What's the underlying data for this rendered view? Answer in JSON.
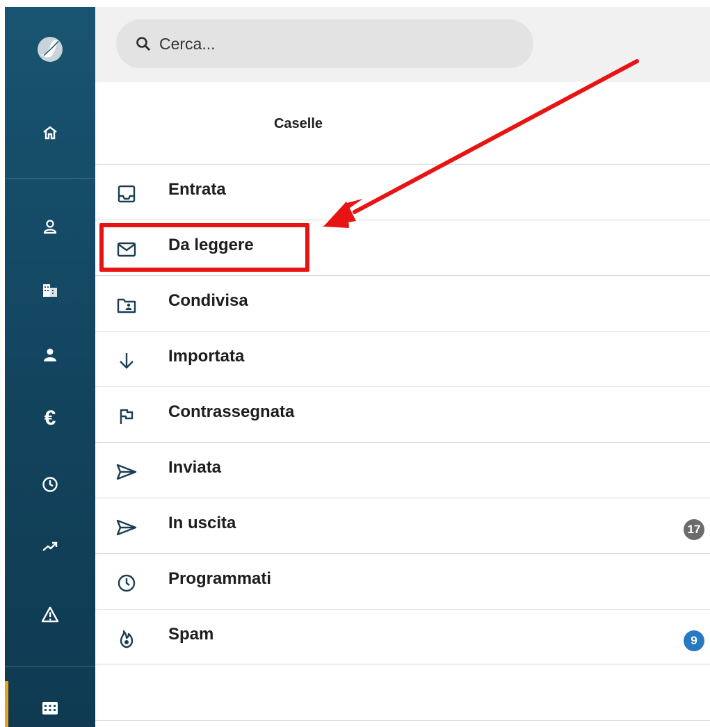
{
  "search": {
    "placeholder": "Cerca..."
  },
  "header": {
    "title": "Caselle"
  },
  "mailboxes": [
    {
      "label": "Entrata",
      "icon": "inbox-icon"
    },
    {
      "label": "Da leggere",
      "icon": "envelope-icon"
    },
    {
      "label": "Condivisa",
      "icon": "shared-folder-icon"
    },
    {
      "label": "Importata",
      "icon": "arrow-down-icon"
    },
    {
      "label": "Contrassegnata",
      "icon": "flag-icon"
    },
    {
      "label": "Inviata",
      "icon": "send-icon"
    },
    {
      "label": "In uscita",
      "icon": "send-icon",
      "badge": "17",
      "badge_color": "#6b6b6b"
    },
    {
      "label": "Programmati",
      "icon": "clock-icon"
    },
    {
      "label": "Spam",
      "icon": "spam-flame-icon",
      "badge": "9",
      "badge_color": "#2779c2"
    }
  ],
  "sidebar": {
    "icons": [
      "app-logo-icon",
      "home-icon",
      "contacts-icon",
      "company-icon",
      "person-icon",
      "euro-icon",
      "clock-icon",
      "trend-icon",
      "warning-icon",
      "grid-apps-icon"
    ],
    "active_accent": "#f0a11b"
  },
  "annotation": {
    "color": "#e81313"
  }
}
